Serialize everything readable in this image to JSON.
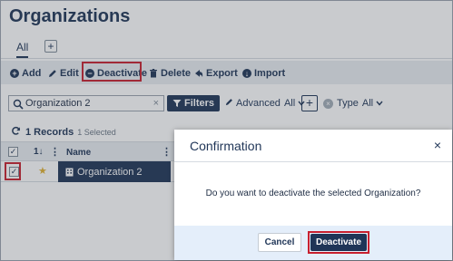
{
  "page": {
    "title": "Organizations"
  },
  "tabs": {
    "all_label": "All",
    "add_symbol": "+"
  },
  "toolbar": {
    "add_label": "Add",
    "edit_label": "Edit",
    "deactivate_label": "Deactivate",
    "delete_label": "Delete",
    "export_label": "Export",
    "import_label": "Import"
  },
  "filterbar": {
    "search_value": "Organization 2",
    "clear_symbol": "×",
    "filters_label": "Filters",
    "advanced_label": "Advanced",
    "advanced_value": "All",
    "plus_symbol": "+",
    "type_label": "Type",
    "type_value": "All"
  },
  "records": {
    "count_label": "1 Records",
    "selected_label": "1 Selected"
  },
  "grid": {
    "columns": {
      "sort_label": "1↓",
      "name_label": "Name"
    },
    "rows": [
      {
        "name": "Organization 2",
        "checked": true
      }
    ]
  },
  "dialog": {
    "title": "Confirmation",
    "close_symbol": "×",
    "message": "Do you want to deactivate the selected Organization?",
    "cancel_label": "Cancel",
    "confirm_label": "Deactivate"
  },
  "colors": {
    "primary": "#1f3557",
    "highlight_frame": "#c8202f",
    "dialog_footer": "#e4eefa",
    "star": "#e1b131"
  },
  "icons": {
    "add": "plus-circle-icon",
    "edit": "pencil-icon",
    "deactivate": "minus-circle-icon",
    "delete": "trash-icon",
    "export": "share-icon",
    "import": "download-circle-icon",
    "refresh": "refresh-icon",
    "favorite": "star-icon",
    "record": "building-icon"
  }
}
